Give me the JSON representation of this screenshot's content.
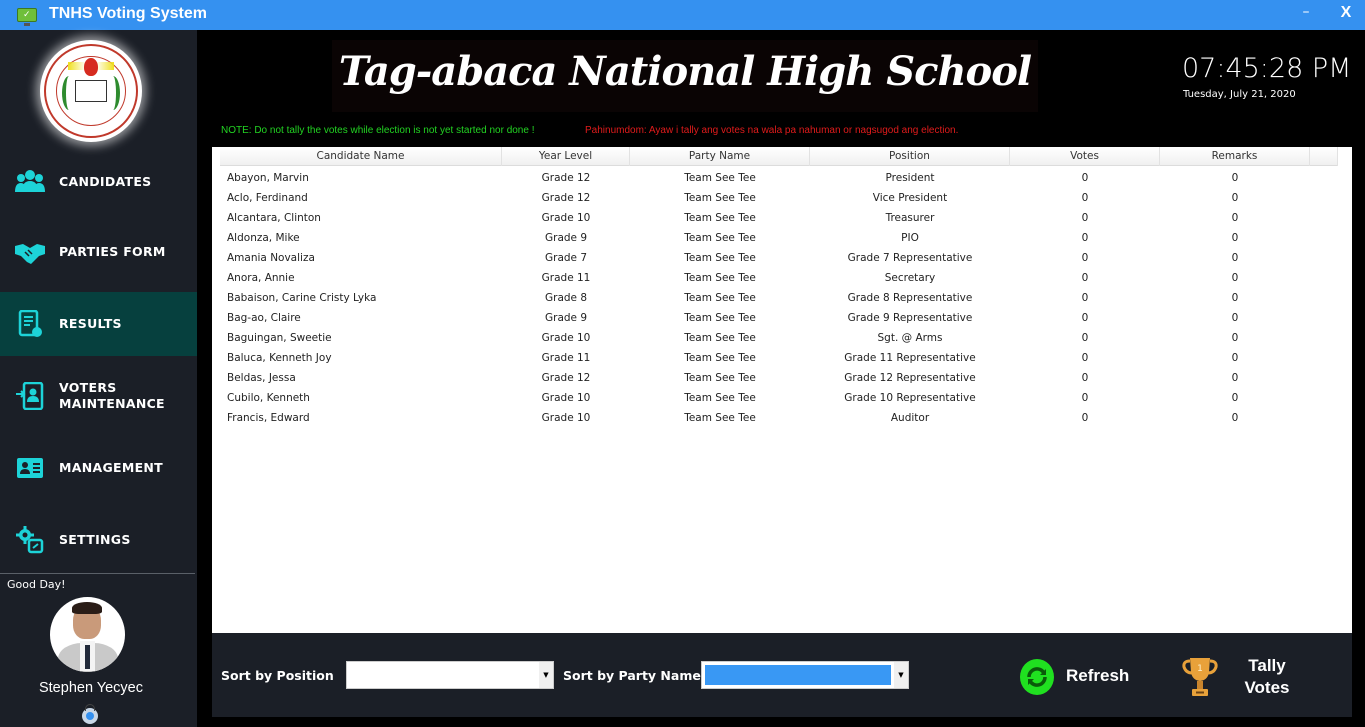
{
  "window": {
    "title": "TNHS Voting System",
    "minimize_label": "–",
    "close_label": "X"
  },
  "sidebar": {
    "items": [
      {
        "label": "CANDIDATES",
        "icon": "people-group-icon",
        "active": false
      },
      {
        "label": "PARTIES FORM",
        "icon": "handshake-icon",
        "active": false
      },
      {
        "label": "RESULTS",
        "icon": "report-document-icon",
        "active": true
      },
      {
        "label": "VOTERS\nMAINTENANCE",
        "label_line1": "VOTERS",
        "label_line2": "MAINTENANCE",
        "icon": "user-login-icon",
        "active": false
      },
      {
        "label": "MANAGEMENT",
        "icon": "id-card-icon",
        "active": false
      },
      {
        "label": "SETTINGS",
        "icon": "gear-settings-icon",
        "active": false
      }
    ],
    "greeting": "Good Day!",
    "user_name": "Stephen Yecyec"
  },
  "header": {
    "school_name": "Tag-abaca National High School",
    "clock": "07:45:28 PM",
    "date": "Tuesday, July 21, 2020",
    "note_en": "NOTE: Do not tally the votes while election is not yet started nor done !",
    "note_ceb": "Pahinumdom: Ayaw i tally ang votes na wala pa nahuman or nagsugod ang election."
  },
  "table": {
    "columns": [
      "Candidate Name",
      "Year Level",
      "Party Name",
      "Position",
      "Votes",
      "Remarks"
    ],
    "rows": [
      [
        "Abayon, Marvin",
        "Grade 12",
        "Team See Tee",
        "President",
        "0",
        "0"
      ],
      [
        "Aclo, Ferdinand",
        "Grade 12",
        "Team See Tee",
        "Vice President",
        "0",
        "0"
      ],
      [
        "Alcantara, Clinton",
        "Grade 10",
        "Team See Tee",
        "Treasurer",
        "0",
        "0"
      ],
      [
        "Aldonza, Mike",
        "Grade 9",
        "Team See Tee",
        "PIO",
        "0",
        "0"
      ],
      [
        "Amania Novaliza",
        "Grade 7",
        "Team See Tee",
        "Grade 7 Representative",
        "0",
        "0"
      ],
      [
        "Anora, Annie",
        "Grade 11",
        "Team See Tee",
        "Secretary",
        "0",
        "0"
      ],
      [
        "Babaison, Carine Cristy Lyka",
        "Grade 8",
        "Team See Tee",
        "Grade 8 Representative",
        "0",
        "0"
      ],
      [
        "Bag-ao, Claire",
        "Grade 9",
        "Team See Tee",
        "Grade 9 Representative",
        "0",
        "0"
      ],
      [
        "Baguingan, Sweetie",
        "Grade 10",
        "Team See Tee",
        "Sgt. @ Arms",
        "0",
        "0"
      ],
      [
        "Baluca, Kenneth Joy",
        "Grade 11",
        "Team See Tee",
        "Grade 11 Representative",
        "0",
        "0"
      ],
      [
        "Beldas, Jessa",
        "Grade 12",
        "Team See Tee",
        "Grade 12 Representative",
        "0",
        "0"
      ],
      [
        "Cubilo, Kenneth",
        "Grade 10",
        "Team See Tee",
        "Grade 10 Representative",
        "0",
        "0"
      ],
      [
        "Francis, Edward",
        "Grade 10",
        "Team See Tee",
        "Auditor",
        "0",
        "0"
      ]
    ]
  },
  "controls": {
    "sort_position_label": "Sort by Position",
    "sort_position_value": "",
    "sort_party_label": "Sort by Party Name",
    "sort_party_value": "",
    "refresh_label": "Refresh",
    "tally_label_line1": "Tally",
    "tally_label_line2": "Votes"
  },
  "colors": {
    "titlebar": "#3591f0",
    "sidebar_bg": "#1b1f27",
    "active_nav": "#06403e",
    "icon_accent": "#1dd3d8",
    "note_green": "#22d322",
    "note_red": "#e01b1b",
    "refresh_green": "#20e020",
    "trophy_gold": "#e8a13a"
  }
}
